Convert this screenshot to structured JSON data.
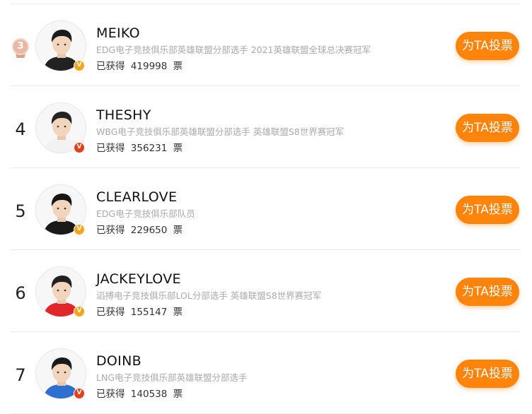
{
  "players": [
    {
      "rank": "3",
      "medal": true,
      "name": "MEIKO",
      "desc": "EDG电子竞技俱乐部英雄联盟分部选手 2021英雄联盟全球总决赛冠军",
      "votes_prefix": "已获得",
      "votes": "419998",
      "votes_suffix": "票",
      "button": "为TA投票",
      "verify_color": "gold",
      "shirt": "#222222",
      "hair": "#1b1b1b"
    },
    {
      "rank": "4",
      "medal": false,
      "name": "THESHY",
      "desc": "WBG电子竞技俱乐部英雄联盟分部选手 英雄联盟S8世界赛冠军",
      "votes_prefix": "已获得",
      "votes": "356231",
      "votes_suffix": "票",
      "button": "为TA投票",
      "verify_color": "red",
      "shirt": "#f2f2f2",
      "hair": "#242424"
    },
    {
      "rank": "5",
      "medal": false,
      "name": "CLEARLOVE",
      "desc": "EDG电子竞技俱乐部队员",
      "votes_prefix": "已获得",
      "votes": "229650",
      "votes_suffix": "票",
      "button": "为TA投票",
      "verify_color": "gold",
      "shirt": "#1a1a1a",
      "hair": "#151515"
    },
    {
      "rank": "6",
      "medal": false,
      "name": "JACKEYLOVE",
      "desc": "滔搏电子竞技俱乐部LOL分部选手 英雄联盟S8世界赛冠军",
      "votes_prefix": "已获得",
      "votes": "155147",
      "votes_suffix": "票",
      "button": "为TA投票",
      "verify_color": "gold",
      "shirt": "#e0262b",
      "hair": "#222222"
    },
    {
      "rank": "7",
      "medal": false,
      "name": "DOINB",
      "desc": "LNG电子竞技俱乐部英雄联盟分部选手",
      "votes_prefix": "已获得",
      "votes": "140538",
      "votes_suffix": "票",
      "button": "为TA投票",
      "verify_color": "red",
      "shirt": "#2f6fd0",
      "hair": "#1a1a1a"
    }
  ],
  "colors": {
    "accent": "#ff8409",
    "verify_gold": "#f3a51b",
    "verify_red": "#e2411b",
    "medal_bronze": "#e9b8a4"
  },
  "icons": {
    "medal": "bronze-medal-icon",
    "verify": "verified-v-icon"
  }
}
